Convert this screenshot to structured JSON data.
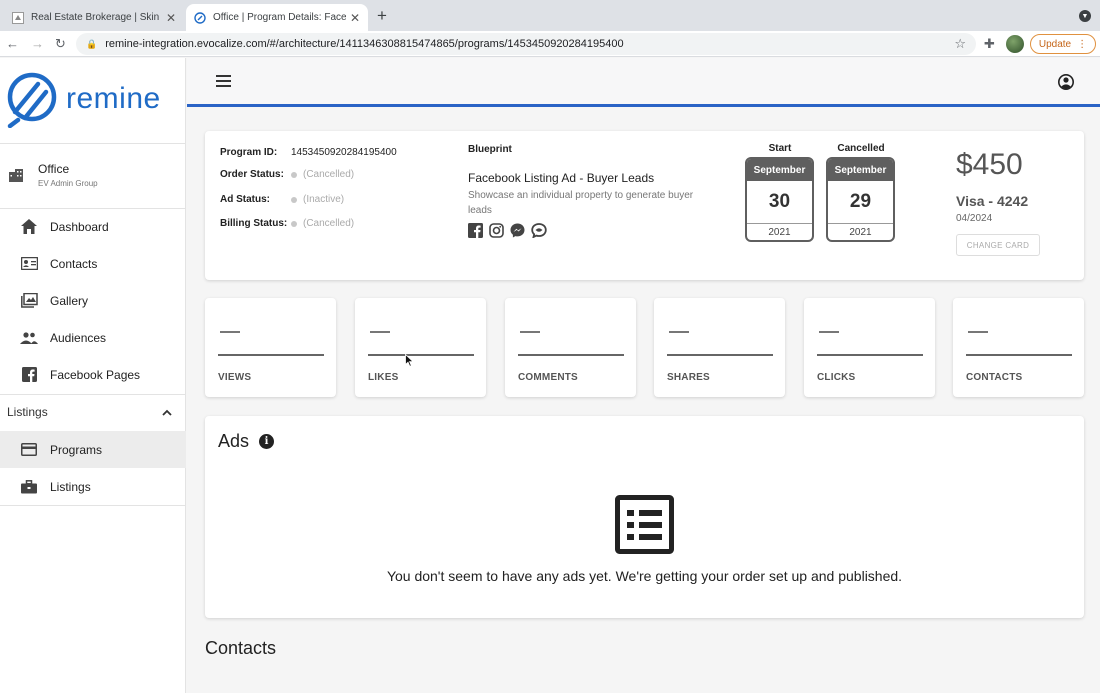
{
  "browser": {
    "tabs": [
      {
        "title": "Real Estate Brokerage | Skin So",
        "active": false
      },
      {
        "title": "Office | Program Details: FaceL",
        "active": true
      }
    ],
    "url": "remine-integration.evocalize.com/#/architecture/1411346308815474865/programs/1453450920284195400",
    "update_label": "Update"
  },
  "brand": {
    "name": "remine",
    "color": "#1f6bc6"
  },
  "sidebar": {
    "office_name": "Office",
    "office_group": "EV Admin Group",
    "items": [
      {
        "label": "Dashboard",
        "icon": "home-icon"
      },
      {
        "label": "Contacts",
        "icon": "contact-card-icon"
      },
      {
        "label": "Gallery",
        "icon": "gallery-icon"
      },
      {
        "label": "Audiences",
        "icon": "people-icon"
      },
      {
        "label": "Facebook Pages",
        "icon": "facebook-icon"
      }
    ],
    "section": {
      "label": "Listings",
      "expanded": true
    },
    "sub_items": [
      {
        "label": "Programs",
        "icon": "credit-card-icon",
        "selected": true
      },
      {
        "label": "Listings",
        "icon": "briefcase-icon",
        "selected": false
      }
    ]
  },
  "program": {
    "id_label": "Program ID:",
    "id_value": "1453450920284195400",
    "order_status_label": "Order Status:",
    "order_status": "(Cancelled)",
    "ad_status_label": "Ad Status:",
    "ad_status": "(Inactive)",
    "billing_status_label": "Billing Status:",
    "billing_status": "(Cancelled)",
    "blueprint_label": "Blueprint",
    "blueprint_name": "Facebook Listing Ad - Buyer Leads",
    "blueprint_desc": "Showcase an individual property to generate buyer leads",
    "channels": [
      "facebook-icon",
      "instagram-icon",
      "messenger-icon",
      "audience-network-icon"
    ],
    "start": {
      "caption": "Start",
      "month": "September",
      "day": "30",
      "year": "2021"
    },
    "end": {
      "caption": "Cancelled",
      "month": "September",
      "day": "29",
      "year": "2021"
    },
    "price": "$450",
    "card": "Visa - 4242",
    "card_exp": "04/2024",
    "change_card_label": "CHANGE CARD"
  },
  "stats": [
    {
      "label": "VIEWS",
      "value": "—"
    },
    {
      "label": "LIKES",
      "value": "—"
    },
    {
      "label": "COMMENTS",
      "value": "—"
    },
    {
      "label": "SHARES",
      "value": "—"
    },
    {
      "label": "CLICKS",
      "value": "—"
    },
    {
      "label": "CONTACTS",
      "value": "—"
    }
  ],
  "ads": {
    "title": "Ads",
    "empty_message": "You don't seem to have any ads yet. We're getting your order set up and published."
  },
  "contacts_title": "Contacts",
  "colors": {
    "accent": "#2a63c6",
    "calendar": "#5f5f5f"
  }
}
